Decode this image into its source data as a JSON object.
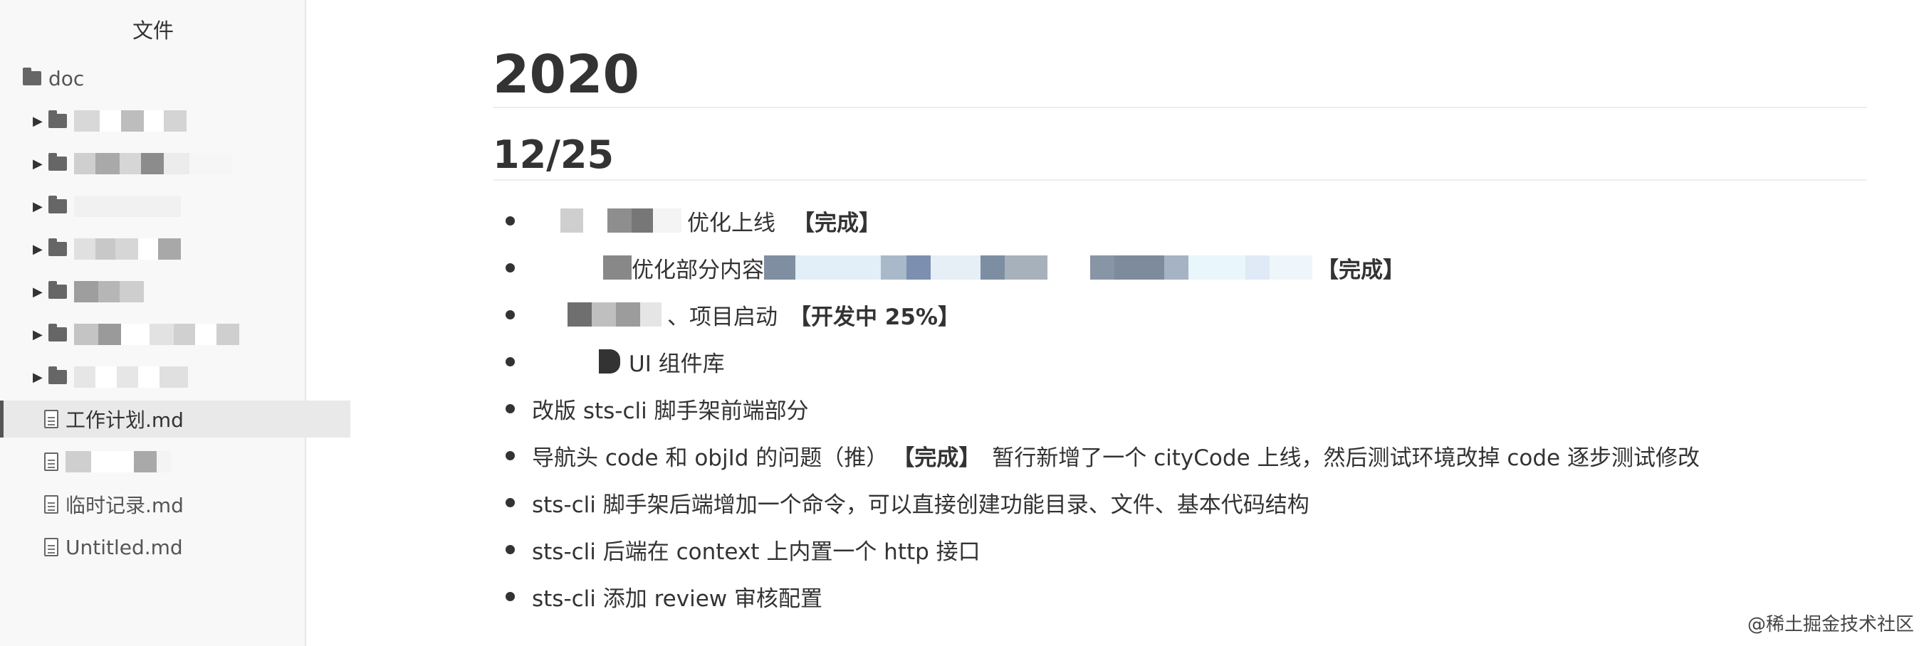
{
  "sidebar": {
    "title": "文件",
    "root_folder": "doc",
    "files": [
      {
        "label": "工作计划.md",
        "active": true
      },
      {
        "label": "临时记录.md",
        "active": false
      },
      {
        "label": "Untitled.md",
        "active": false
      }
    ]
  },
  "document": {
    "heading_year": "2020",
    "heading_date": "12/25",
    "tasks": [
      {
        "text": "优化上线",
        "tag": "【完成】"
      },
      {
        "text": "优化部分内容",
        "tag": "【完成】"
      },
      {
        "text": "、项目启动",
        "tag": "【开发中 25%】"
      },
      {
        "text": "UI 组件库",
        "tag": ""
      },
      {
        "text": "改版 sts-cli 脚手架前端部分",
        "tag": ""
      },
      {
        "text": "导航头 code 和 objId 的问题（推）",
        "tag": "【完成】",
        "after": "暂行新增了一个 cityCode 上线，然后测试环境改掉 code 逐步测试修改"
      },
      {
        "text": "sts-cli 脚手架后端增加一个命令，可以直接创建功能目录、文件、基本代码结构",
        "tag": ""
      },
      {
        "text": "sts-cli 后端在 context 上内置一个 http 接口",
        "tag": ""
      },
      {
        "text": "sts-cli 添加 review 审核配置",
        "tag": ""
      }
    ]
  },
  "watermark": "@稀土掘金技术社区"
}
